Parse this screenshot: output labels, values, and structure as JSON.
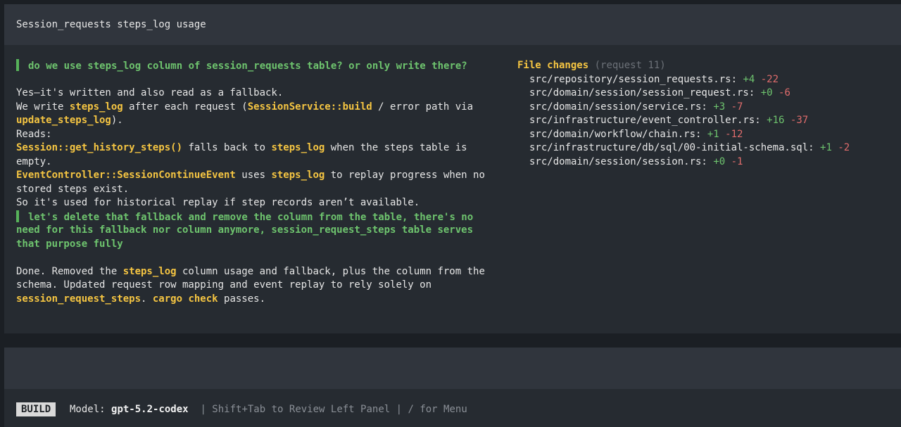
{
  "header": {
    "title": "Session_requests steps_log usage"
  },
  "conversation": {
    "user1": "do we use steps_log column of session_requests table? or only write there?",
    "a1": "Yes—it's written and also read as a fallback.",
    "a2_1": "We write ",
    "a2_2": "steps_log",
    "a2_3": " after each request (",
    "a2_4": "SessionService::build",
    "a2_5": " / error path via",
    "a3_1": "update_steps_log",
    "a3_2": ").",
    "a4": "Reads:",
    "a5_1": "Session::get_history_steps()",
    "a5_2": " falls back to ",
    "a5_3": "steps_log",
    "a5_4": " when the steps table is",
    "a6": "empty.",
    "a7_1": "EventController::SessionContinueEvent",
    "a7_2": " uses ",
    "a7_3": "steps_log",
    "a7_4": " to replay progress when no",
    "a8": "stored steps exist.",
    "a9": "So it's used for historical replay if step records aren’t available.",
    "user2_l1": "let's delete that fallback and remove the column from the table, there's no",
    "user2_l2": "need for this fallback nor column anymore, session_request_steps table serves",
    "user2_l3": "that purpose fully",
    "b1_1": "Done. Removed the ",
    "b1_2": "steps_log",
    "b1_3": " column usage and fallback, plus the column from the",
    "b2": "schema. Updated request row mapping and event replay to rely solely on",
    "b3_1": "session_request_steps",
    "b3_2": ". ",
    "b3_3": "cargo check",
    "b3_4": " passes."
  },
  "file_changes": {
    "title": "File changes",
    "request": "(request 11)",
    "files": [
      {
        "path": "src/repository/session_requests.rs:",
        "add": "+4",
        "del": "-22"
      },
      {
        "path": "src/domain/session/session_request.rs:",
        "add": "+0",
        "del": "-6"
      },
      {
        "path": "src/domain/session/service.rs:",
        "add": "+3",
        "del": "-7"
      },
      {
        "path": "src/infrastructure/event_controller.rs:",
        "add": "+16",
        "del": "-37"
      },
      {
        "path": "src/domain/workflow/chain.rs:",
        "add": "+1",
        "del": "-12"
      },
      {
        "path": "src/infrastructure/db/sql/00-initial-schema.sql:",
        "add": "+1",
        "del": "-2"
      },
      {
        "path": "src/domain/session/session.rs:",
        "add": "+0",
        "del": "-1"
      }
    ]
  },
  "status": {
    "mode": "BUILD",
    "model_label": "Model:",
    "model_value": "gpt-5.2-codex",
    "hint": "| Shift+Tab to Review Left Panel | / for Menu"
  },
  "colors": {
    "background": "#262b31",
    "header": "#30353d",
    "highlight": "#f5c542",
    "user_text": "#6ec46e",
    "deletions": "#e06c6c"
  }
}
